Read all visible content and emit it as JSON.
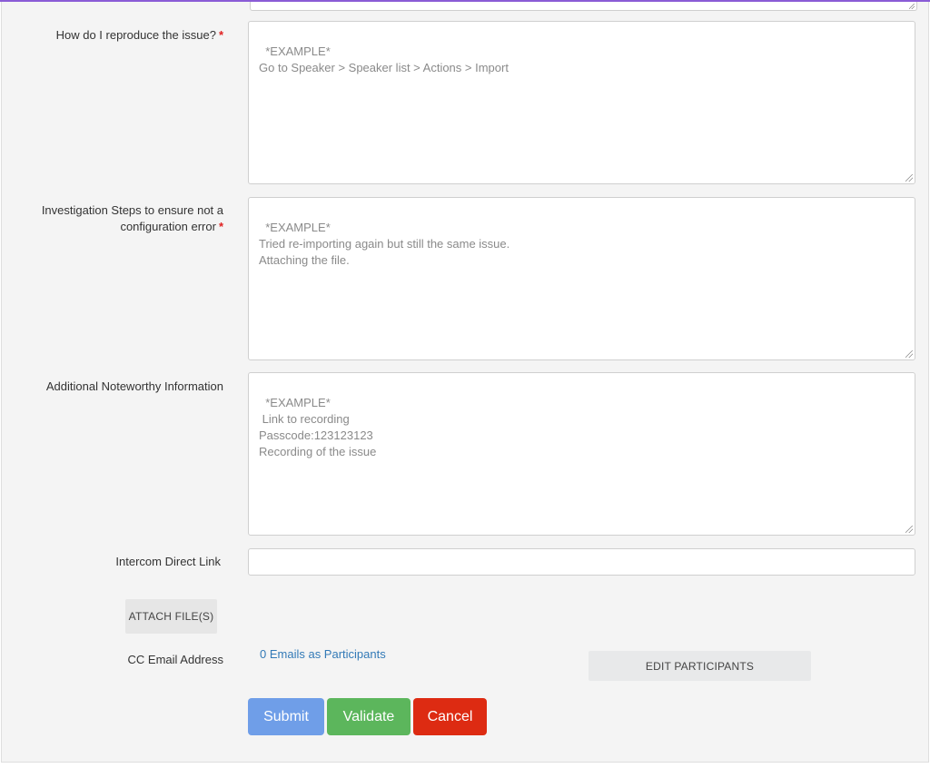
{
  "form": {
    "reproduce": {
      "label": "How do I reproduce the issue?",
      "required_mark": "*",
      "placeholder": "*EXAMPLE*\nGo to Speaker > Speaker list > Actions > Import"
    },
    "investigation": {
      "label_line1": "Investigation Steps to ensure not a",
      "label_line2": "configuration error",
      "required_mark": "*",
      "placeholder": "*EXAMPLE*\nTried re-importing again but still the same issue.\nAttaching the file."
    },
    "additional": {
      "label": "Additional Noteworthy Information",
      "placeholder": "*EXAMPLE*\n Link to recording\nPasscode:123123123\nRecording of the issue"
    },
    "intercom": {
      "label": "Intercom Direct Link",
      "value": ""
    },
    "attach": {
      "label": "ATTACH FILE(S)"
    },
    "cc": {
      "label": "CC Email Address",
      "link_text": "0 Emails as Participants",
      "edit_label": "EDIT PARTICIPANTS"
    },
    "actions": {
      "submit": "Submit",
      "validate": "Validate",
      "cancel": "Cancel"
    }
  },
  "colors": {
    "accent_top": "#8a5cd6",
    "submit": "#6f9ee8",
    "validate": "#5cb65c",
    "cancel": "#dd2b12",
    "link": "#337ab7",
    "required": "#e02020"
  }
}
